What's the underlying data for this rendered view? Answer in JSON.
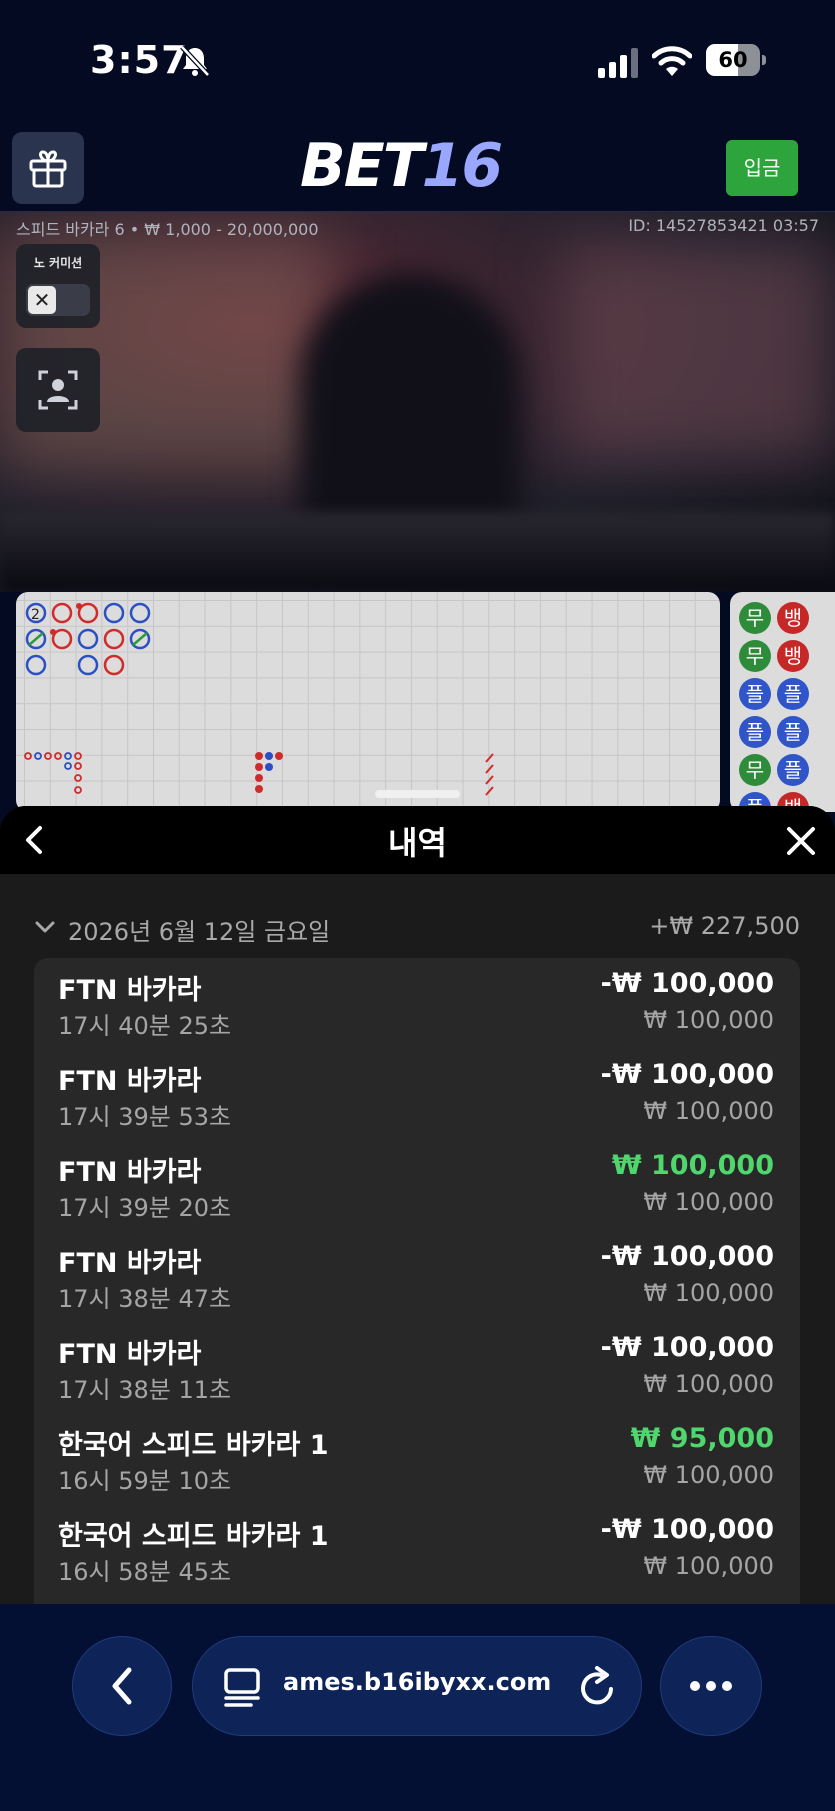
{
  "status_bar": {
    "time": "3:57",
    "battery": "60",
    "battery_level": 0.6,
    "icons": [
      "bell-slash-icon",
      "signal-icon",
      "wifi-icon",
      "battery-icon"
    ]
  },
  "header": {
    "logo_part1": "BET",
    "logo_part2": "16",
    "deposit_label": "입금",
    "colors": {
      "deposit": "#2ea43c",
      "logo_accent": "#9aa7ff"
    }
  },
  "game": {
    "table_info": "스피드 바카라 6 • ₩ 1,000 - 20,000,000",
    "round_id": "ID: 14527853421 03:57",
    "commission_label": "노 커미션"
  },
  "roadmap": {
    "side_labels": [
      "무",
      "뱅",
      "무",
      "뱅",
      "플",
      "플",
      "플",
      "플",
      "무",
      "플",
      "플",
      "뱅"
    ]
  },
  "history": {
    "title": "내역",
    "date": "2026년 6월 12일 금요일",
    "date_total": "+₩ 227,500",
    "rows": [
      {
        "game": "FTN 바카라",
        "time": "17시 40분 25초",
        "result": "-₩ 100,000",
        "stake": "₩ 100,000",
        "win": false
      },
      {
        "game": "FTN 바카라",
        "time": "17시 39분 53초",
        "result": "-₩ 100,000",
        "stake": "₩ 100,000",
        "win": false
      },
      {
        "game": "FTN 바카라",
        "time": "17시 39분 20초",
        "result": "₩ 100,000",
        "stake": "₩ 100,000",
        "win": true
      },
      {
        "game": "FTN 바카라",
        "time": "17시 38분 47초",
        "result": "-₩ 100,000",
        "stake": "₩ 100,000",
        "win": false
      },
      {
        "game": "FTN 바카라",
        "time": "17시 38분 11초",
        "result": "-₩ 100,000",
        "stake": "₩ 100,000",
        "win": false
      },
      {
        "game": "한국어 스피드 바카라 1",
        "time": "16시 59분 10초",
        "result": "₩ 95,000",
        "stake": "₩ 100,000",
        "win": true
      },
      {
        "game": "한국어 스피드 바카라 1",
        "time": "16시 58분 45초",
        "result": "-₩ 100,000",
        "stake": "₩ 100,000",
        "win": false
      }
    ]
  },
  "browser": {
    "url": "ames.b16ibyxx.com",
    "icons": [
      "back-icon",
      "tabs-icon",
      "reload-icon",
      "more-icon"
    ]
  }
}
